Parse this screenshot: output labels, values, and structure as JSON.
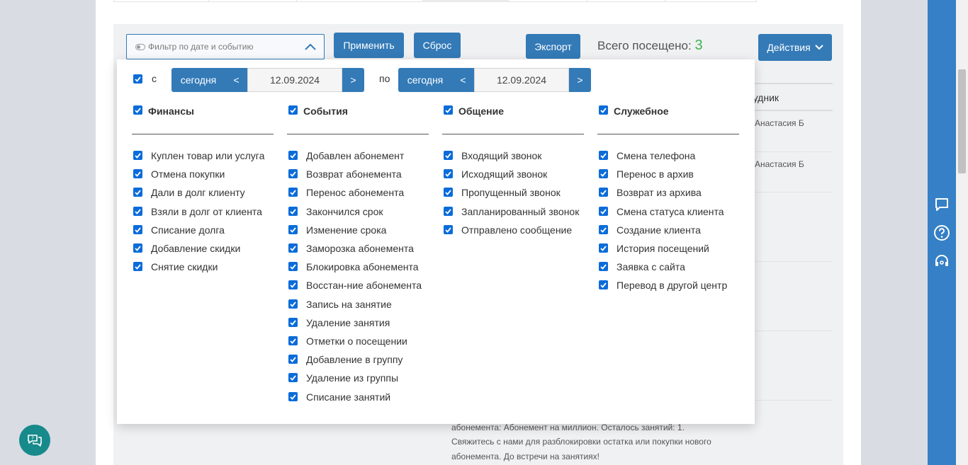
{
  "toolbar": {
    "filter_placeholder": "Фильтр по дате и событию",
    "apply_label": "Применить",
    "reset_label": "Сброс",
    "export_label": "Экспорт",
    "visits_label": "Всего посещено:",
    "visits_count": "3",
    "actions_label": "Действия"
  },
  "background": {
    "column_header": "рудник",
    "row1": "Анастасия Б",
    "row2": "Анастасия Б",
    "message_line1": "абонемента: Абонемент на миллион. Осталось занятий: 1.",
    "message_line2": "Свяжитесь с нами для разблокировки остатка или покупки нового",
    "message_line3": "абонемента. До встречи на занятиях!"
  },
  "filter": {
    "from_label": "с",
    "to_label": "по",
    "from": {
      "today": "сегодня",
      "prev": "<",
      "date": "12.09.2024",
      "next": ">"
    },
    "to": {
      "today": "сегодня",
      "prev": "<",
      "date": "12.09.2024",
      "next": ">"
    },
    "groups": [
      {
        "title": "Финансы",
        "items": [
          "Куплен товар или услуга",
          "Отмена покупки",
          "Дали в долг клиенту",
          "Взяли в долг от клиента",
          "Списание долга",
          "Добавление скидки",
          "Снятие скидки"
        ]
      },
      {
        "title": "События",
        "items": [
          "Добавлен абонемент",
          "Возврат абонемента",
          "Перенос абонемента",
          "Закончился срок",
          "Изменение срока",
          "Заморозка абонемента",
          "Блокировка абонемента",
          "Восстан-ние абонемента",
          "Запись на занятие",
          "Удаление занятия",
          "Отметки о посещении",
          "Добавление в группу",
          "Удаление из группы",
          "Списание занятий"
        ]
      },
      {
        "title": "Общение",
        "items": [
          "Входящий звонок",
          "Исходящий звонок",
          "Пропущенный звонок",
          "Запланированный звонок",
          "Отправлено сообщение"
        ]
      },
      {
        "title": "Служебное",
        "items": [
          "Смена телефона",
          "Перенос в архив",
          "Возврат из архива",
          "Смена статуса клиента",
          "Создание клиента",
          "История посещений",
          "Заявка с сайта",
          "Перевод в другой центр"
        ]
      }
    ]
  },
  "sidebar_icons": [
    "chat-icon",
    "help-icon",
    "support-icon"
  ],
  "colors": {
    "primary": "#337ab7",
    "checkbox": "#0b6cd9",
    "sidebar": "#3580c6",
    "success": "#3fb34f",
    "fab": "#178a8c"
  }
}
